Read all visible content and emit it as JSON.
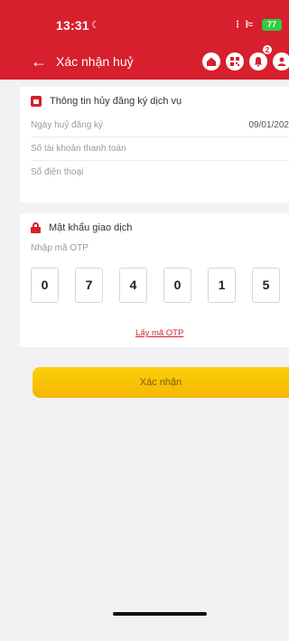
{
  "status_bar": {
    "time": "13:31",
    "battery": "77"
  },
  "header": {
    "title": "Xác nhận huỷ",
    "notification_count": "2"
  },
  "service_info": {
    "heading": "Thông tin hủy đăng ký dịch vụ",
    "rows": [
      {
        "label": "Ngày huỷ đăng ký",
        "value": "09/01/202"
      },
      {
        "label": "Số tài khoản thanh toán",
        "value": ""
      },
      {
        "label": "Số điện thoại",
        "value": ""
      }
    ]
  },
  "transaction_password": {
    "heading": "Mật khẩu giao dịch",
    "otp_label": "Nhập mã OTP",
    "otp_digits": [
      "0",
      "7",
      "4",
      "0",
      "1",
      "5"
    ],
    "get_otp_link": "Lấy mã OTP"
  },
  "confirm_button": "Xác nhận",
  "colors": {
    "brand_red": "#d71f2d",
    "button_yellow": "#f9c406",
    "background": "#f2f2f4"
  },
  "icons": [
    "back-arrow-icon",
    "home-icon",
    "qr-icon",
    "notification-bell-icon",
    "avatar-icon",
    "calendar-icon",
    "lock-icon",
    "silent-mode-icon",
    "signal-icon",
    "wifi-icon",
    "battery-icon"
  ]
}
